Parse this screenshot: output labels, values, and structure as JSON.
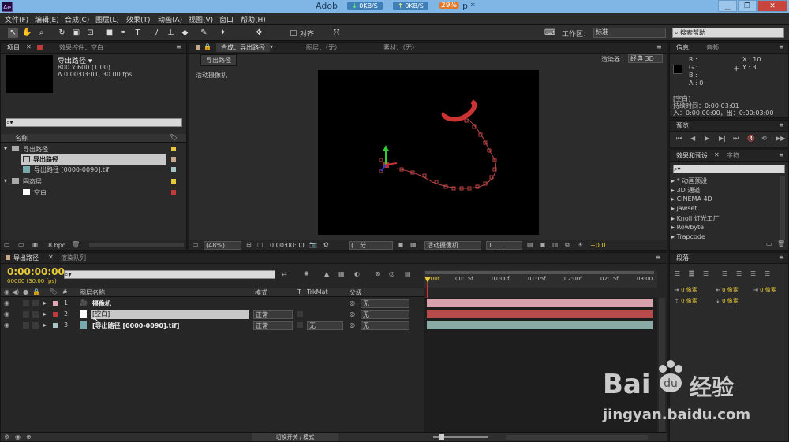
{
  "titlebar": {
    "app": "Adob",
    "net_down": "0KB/S",
    "net_up": "0KB/S",
    "cpu": "29%",
    "title_rest": "p *",
    "min": "▁",
    "max": "❐",
    "close": "✕",
    "ae_logo": "Ae"
  },
  "menu": [
    "文件(F)",
    "编辑(E)",
    "合成(C)",
    "图层(L)",
    "效果(T)",
    "动画(A)",
    "视图(V)",
    "窗口",
    "帮助(H)"
  ],
  "toolbar": {
    "align_label": "对齐",
    "workspace_label": "工作区：",
    "workspace_value": "标准",
    "search_placeholder": "搜索帮助"
  },
  "project": {
    "tabs": [
      "项目",
      "效果控件：空白"
    ],
    "comp_name": "导出路径 ▾",
    "comp_size": "800 x 600 (1.00)",
    "comp_dur": "Δ 0:00:03:01, 30.00 fps",
    "col_name": "名称",
    "items": [
      {
        "name": "导出路径",
        "kind": "folder"
      },
      {
        "name": "导出路径",
        "kind": "comp"
      },
      {
        "name": "导出路径 [0000-0090].tif",
        "kind": "footage"
      },
      {
        "name": "固态层",
        "kind": "folder"
      },
      {
        "name": "空白",
        "kind": "solid"
      }
    ],
    "bpc": "8 bpc",
    "colors": {
      "folder": "#e5c93a",
      "comp": "#c7a88a",
      "footage": "#a6c4c4",
      "solid": "#c03a3a"
    }
  },
  "composition": {
    "tabs": [
      "合成：导出路径",
      "图层：（无）",
      "素材：（无）"
    ],
    "subtab": "导出路径",
    "renderer_label": "渲染器：",
    "renderer_value": "经典 3D",
    "camera_label": "活动摄像机",
    "footer": {
      "zoom": "(48%)",
      "time": "0:00:00:00",
      "res": "(二分…",
      "view": "活动摄像机",
      "views": "1 …",
      "exposure": "+0.0"
    }
  },
  "info": {
    "tabs": [
      "信息",
      "音频"
    ],
    "rgba": [
      "R :",
      "G :",
      "B :",
      "A : 0"
    ],
    "xy": [
      "X : 10",
      "Y : 3"
    ],
    "layer_name": "[空白]",
    "duration": "持续时间：0:00:03:01",
    "in_out": "入：0:00:00:00，出：0:00:03:00"
  },
  "preview": {
    "tab": "预览"
  },
  "effects": {
    "tabs": [
      "效果和预设",
      "字符"
    ],
    "list": [
      "* 动画预设",
      "3D 通道",
      "CINEMA 4D",
      "jawset",
      "Knoll 灯光工厂",
      "Rowbyte",
      "Trapcode"
    ]
  },
  "paragraph": {
    "tab": "段落",
    "fields": [
      "0 像素",
      "0 像素",
      "0 像素",
      "0 像素",
      "0 像素"
    ]
  },
  "timeline": {
    "tabs": [
      "导出路径",
      "渲染队列"
    ],
    "timecode": "0:00:00:00",
    "fps": "00000 (30.00 fps)",
    "headers": {
      "num": "#",
      "name": "图层名称",
      "mode": "模式",
      "t": "T",
      "trkmat": "TrkMat",
      "parent": "父级"
    },
    "ruler": [
      "0:00f",
      "00:15f",
      "01:00f",
      "01:15f",
      "02:00f",
      "02:15f",
      "03:00"
    ],
    "layers": [
      {
        "num": "1",
        "name": "摄像机",
        "mode": "",
        "trkmat": "",
        "parent": "无",
        "color": "#e4a5b5",
        "bar": "#d9a0ae"
      },
      {
        "num": "2",
        "name": "[空白]",
        "mode": "正常",
        "trkmat": "",
        "parent": "无",
        "color": "#c03a3a",
        "bar": "#b94a4a"
      },
      {
        "num": "3",
        "name": "[导出路径 [0000-0090].tif]",
        "mode": "正常",
        "trkmat": "无",
        "parent": "无",
        "color": "#a6c4c4",
        "bar": "#8aaaa6"
      }
    ],
    "footer": "切换开关 / 模式"
  },
  "watermark": {
    "brand": "Bai",
    "brand2": "经验",
    "url": "jingyan.baidu.com"
  }
}
